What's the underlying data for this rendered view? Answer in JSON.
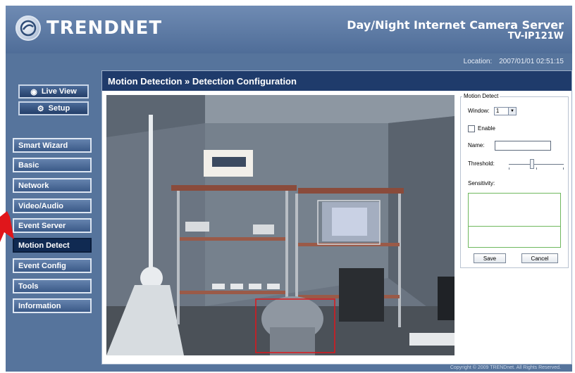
{
  "brand": {
    "name": "TRENDNET"
  },
  "product": {
    "title": "Day/Night Internet Camera Server",
    "model": "TV-IP121W"
  },
  "location_bar": {
    "label": "Location:",
    "datetime": "2007/01/01 02:51:15"
  },
  "view_buttons": [
    {
      "label": "Live View",
      "icon": "eye-icon"
    },
    {
      "label": "Setup",
      "icon": "gear-icon"
    }
  ],
  "nav": {
    "items": [
      {
        "label": "Smart Wizard"
      },
      {
        "label": "Basic"
      },
      {
        "label": "Network"
      },
      {
        "label": "Video/Audio"
      },
      {
        "label": "Event Server"
      },
      {
        "label": "Motion Detect",
        "active": true
      },
      {
        "label": "Event Config"
      },
      {
        "label": "Tools"
      },
      {
        "label": "Information"
      }
    ]
  },
  "main": {
    "title": "Motion Detection » Detection Configuration"
  },
  "motion_panel": {
    "legend": "Motion Detect",
    "window_label": "Window:",
    "window_value": "1",
    "enable_label": "Enable",
    "name_label": "Name:",
    "name_value": "",
    "threshold_label": "Threshold:",
    "sensitivity_label": "Sensitivity:",
    "save_label": "Save",
    "cancel_label": "Cancel"
  },
  "footer": {
    "copyright": "Copyright © 2009 TRENDnet. All Rights Reserved."
  },
  "colors": {
    "header": "#56749c",
    "title_bar": "#1f3b6b",
    "active_nav": "#102a52",
    "annotation_arrow": "#e0161b"
  }
}
